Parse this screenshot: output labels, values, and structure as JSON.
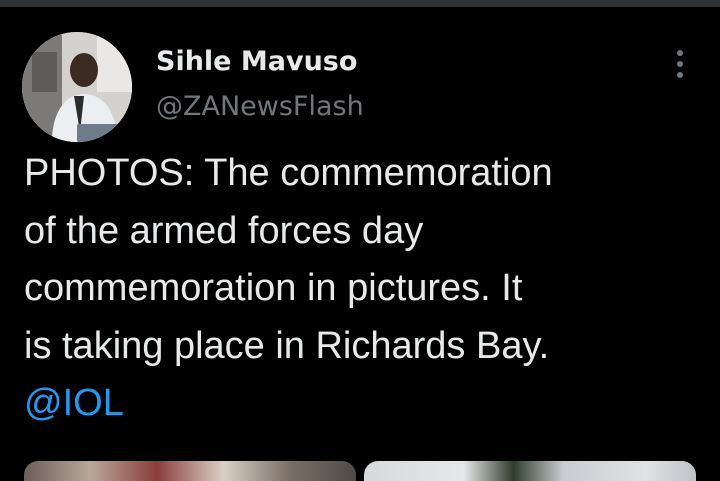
{
  "author": {
    "display_name": "Sihle Mavuso",
    "handle": "@ZANewsFlash",
    "avatar_icon": "user-avatar-photo"
  },
  "tweet": {
    "lines": [
      "PHOTOS: The commemoration",
      "of the armed forces day",
      "commemoration in pictures. It",
      "is taking place in Richards Bay."
    ],
    "mention": "@IOL"
  },
  "menu": {
    "icon": "more-options-icon"
  },
  "colors": {
    "background": "#000000",
    "text": "#e7e9ea",
    "secondary": "#71767b",
    "link": "#1d9bf0"
  }
}
